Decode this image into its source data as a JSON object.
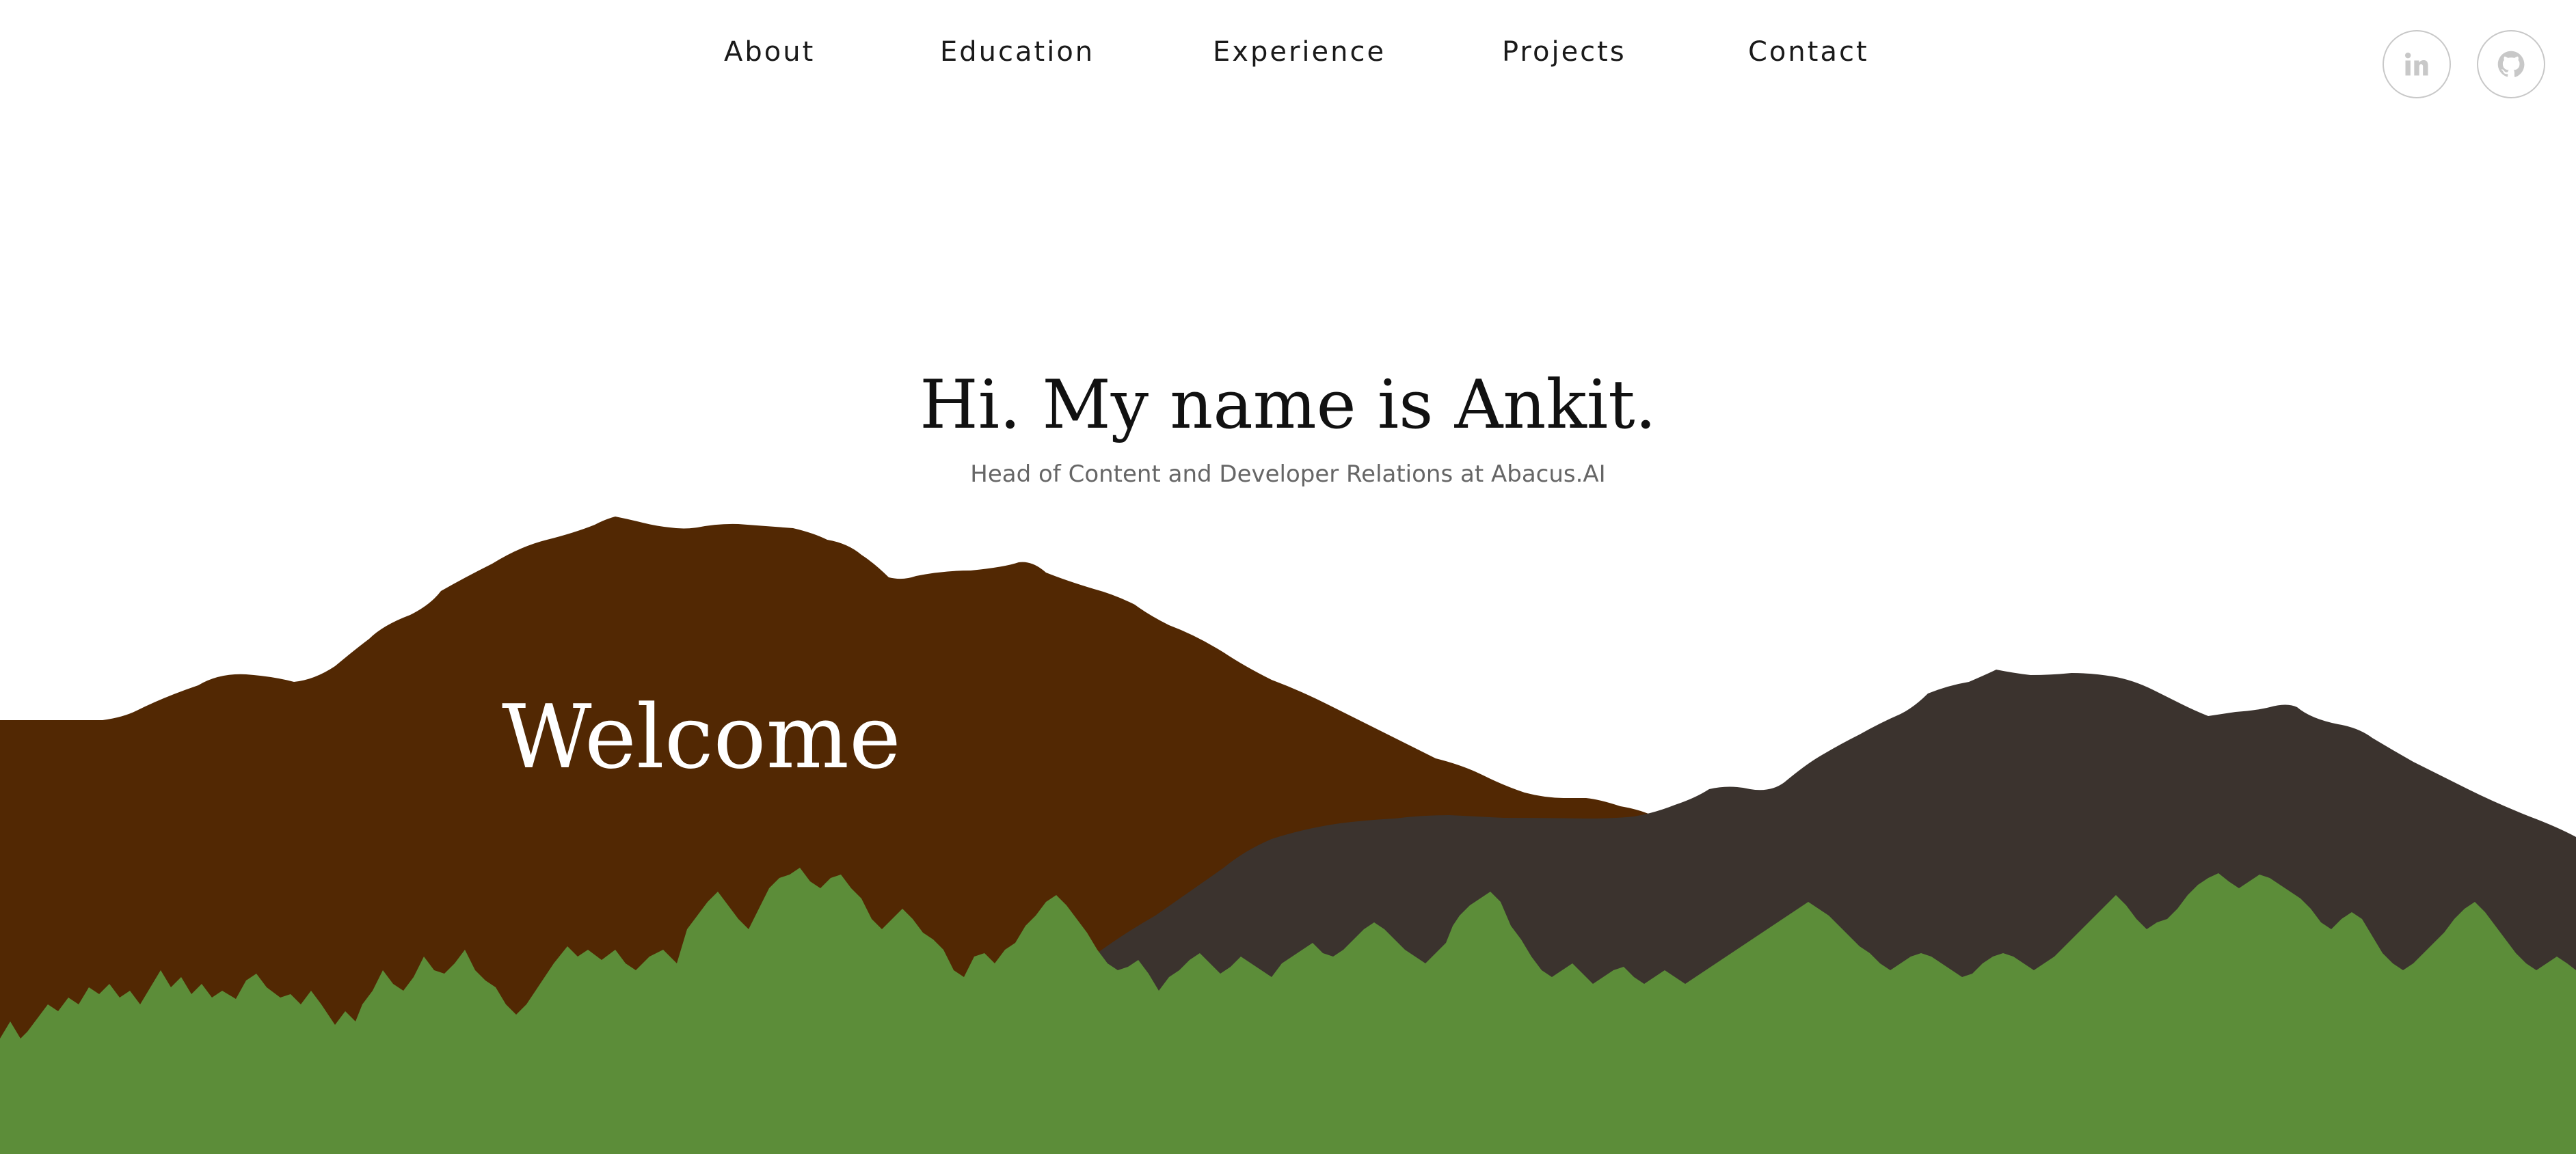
{
  "nav": {
    "items": [
      {
        "label": "About"
      },
      {
        "label": "Education"
      },
      {
        "label": "Experience"
      },
      {
        "label": "Projects"
      },
      {
        "label": "Contact"
      }
    ]
  },
  "social": {
    "icons": [
      "linkedin-icon",
      "github-icon"
    ]
  },
  "hero": {
    "title": "Hi. My name is Ankit.",
    "subtitle": "Head of Content and Developer Relations at Abacus.AI",
    "welcome": "Welcome"
  },
  "colors": {
    "background": "#ffffff",
    "brown_mountain": "#522803",
    "dark_mountain": "#3b332e",
    "forest": "#5c8d39",
    "icon_gray": "#c8c8c8"
  }
}
